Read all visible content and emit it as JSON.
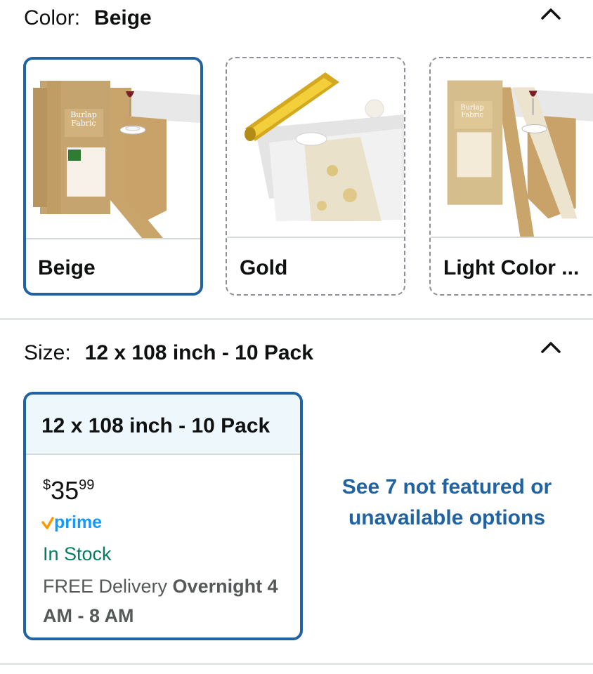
{
  "color_section": {
    "label": "Color:",
    "selected_value": "Beige",
    "options": [
      {
        "name": "Beige",
        "selected": true
      },
      {
        "name": "Gold",
        "selected": false
      },
      {
        "name": "Light Color ...",
        "selected": false
      }
    ]
  },
  "size_section": {
    "label": "Size:",
    "selected_value": "12 x 108 inch - 10 Pack",
    "card": {
      "title": "12 x 108 inch - 10 Pack",
      "price_symbol": "$",
      "price_whole": "35",
      "price_fraction": "99",
      "prime_label": "prime",
      "stock": "In Stock",
      "delivery_prefix": "FREE Delivery",
      "delivery_time": "Overnight 4 AM - 8 AM"
    },
    "see_more": "See 7 not featured or unavailable options"
  },
  "colors": {
    "accent": "#2162a1",
    "in_stock": "#067d62",
    "prime_blue": "#1399ff",
    "prime_orange": "#ff9900",
    "card_header": "#edf7fc"
  },
  "icons": [
    "chevron-up-icon",
    "prime-check-icon"
  ]
}
